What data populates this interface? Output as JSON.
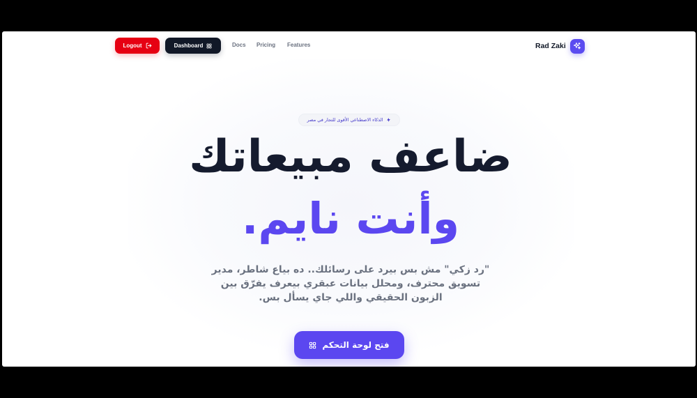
{
  "nav": {
    "logout_label": "Logout",
    "dashboard_label": "Dashboard",
    "links": [
      "Docs",
      "Pricing",
      "Features"
    ],
    "brand_name": "Rad Zaki"
  },
  "hero": {
    "badge_text": "الذكاء الاصطناعي الأقوى للتجار في مصر",
    "headline_line1": "ضاعف مبيعاتك",
    "headline_line2": "وأنت نايم",
    "headline_dot": ".",
    "description": "\"رد زكي\" مش بس بيرد على رسائلك.. ده بياع شاطر، مدير تسويق محترف، ومحلل بيانات عبقري بيعرف يفرّق بين الزبون الحقيقي واللي جاي يسأل بس.",
    "cta_label": "فتح لوحة التحكم"
  },
  "colors": {
    "accent": "#5b47f0",
    "logout": "#e60012",
    "dark": "#111827",
    "text_muted": "#6b7280"
  },
  "icons": {
    "logout": "logout-icon",
    "dashboard": "grid-icon",
    "brand": "sparkles-icon",
    "badge": "lightning-icon",
    "cta": "grid-icon"
  }
}
